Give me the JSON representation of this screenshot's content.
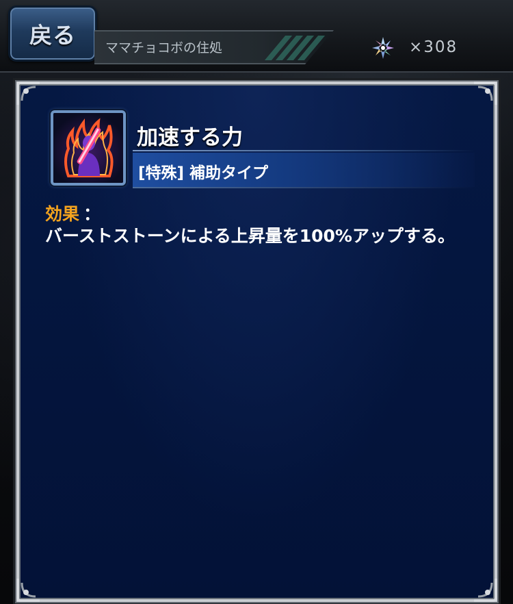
{
  "header": {
    "back_label": "戻る",
    "location": "ママチョコボの住処",
    "currency": {
      "icon": "crystal-icon",
      "count": "×308"
    }
  },
  "ability": {
    "icon": "burning-sword-figure-icon",
    "name": "加速する力",
    "type": "[特殊] 補助タイプ",
    "effect_heading": "効果",
    "effect_colon": "：",
    "effect_text": "バーストストーンによる上昇量を100%アップする。"
  },
  "colors": {
    "accent_orange": "#f3a31e",
    "panel_navy": "#031237",
    "band_blue": "#1f4ea0",
    "back_button_blue": "#1f3a5c"
  }
}
